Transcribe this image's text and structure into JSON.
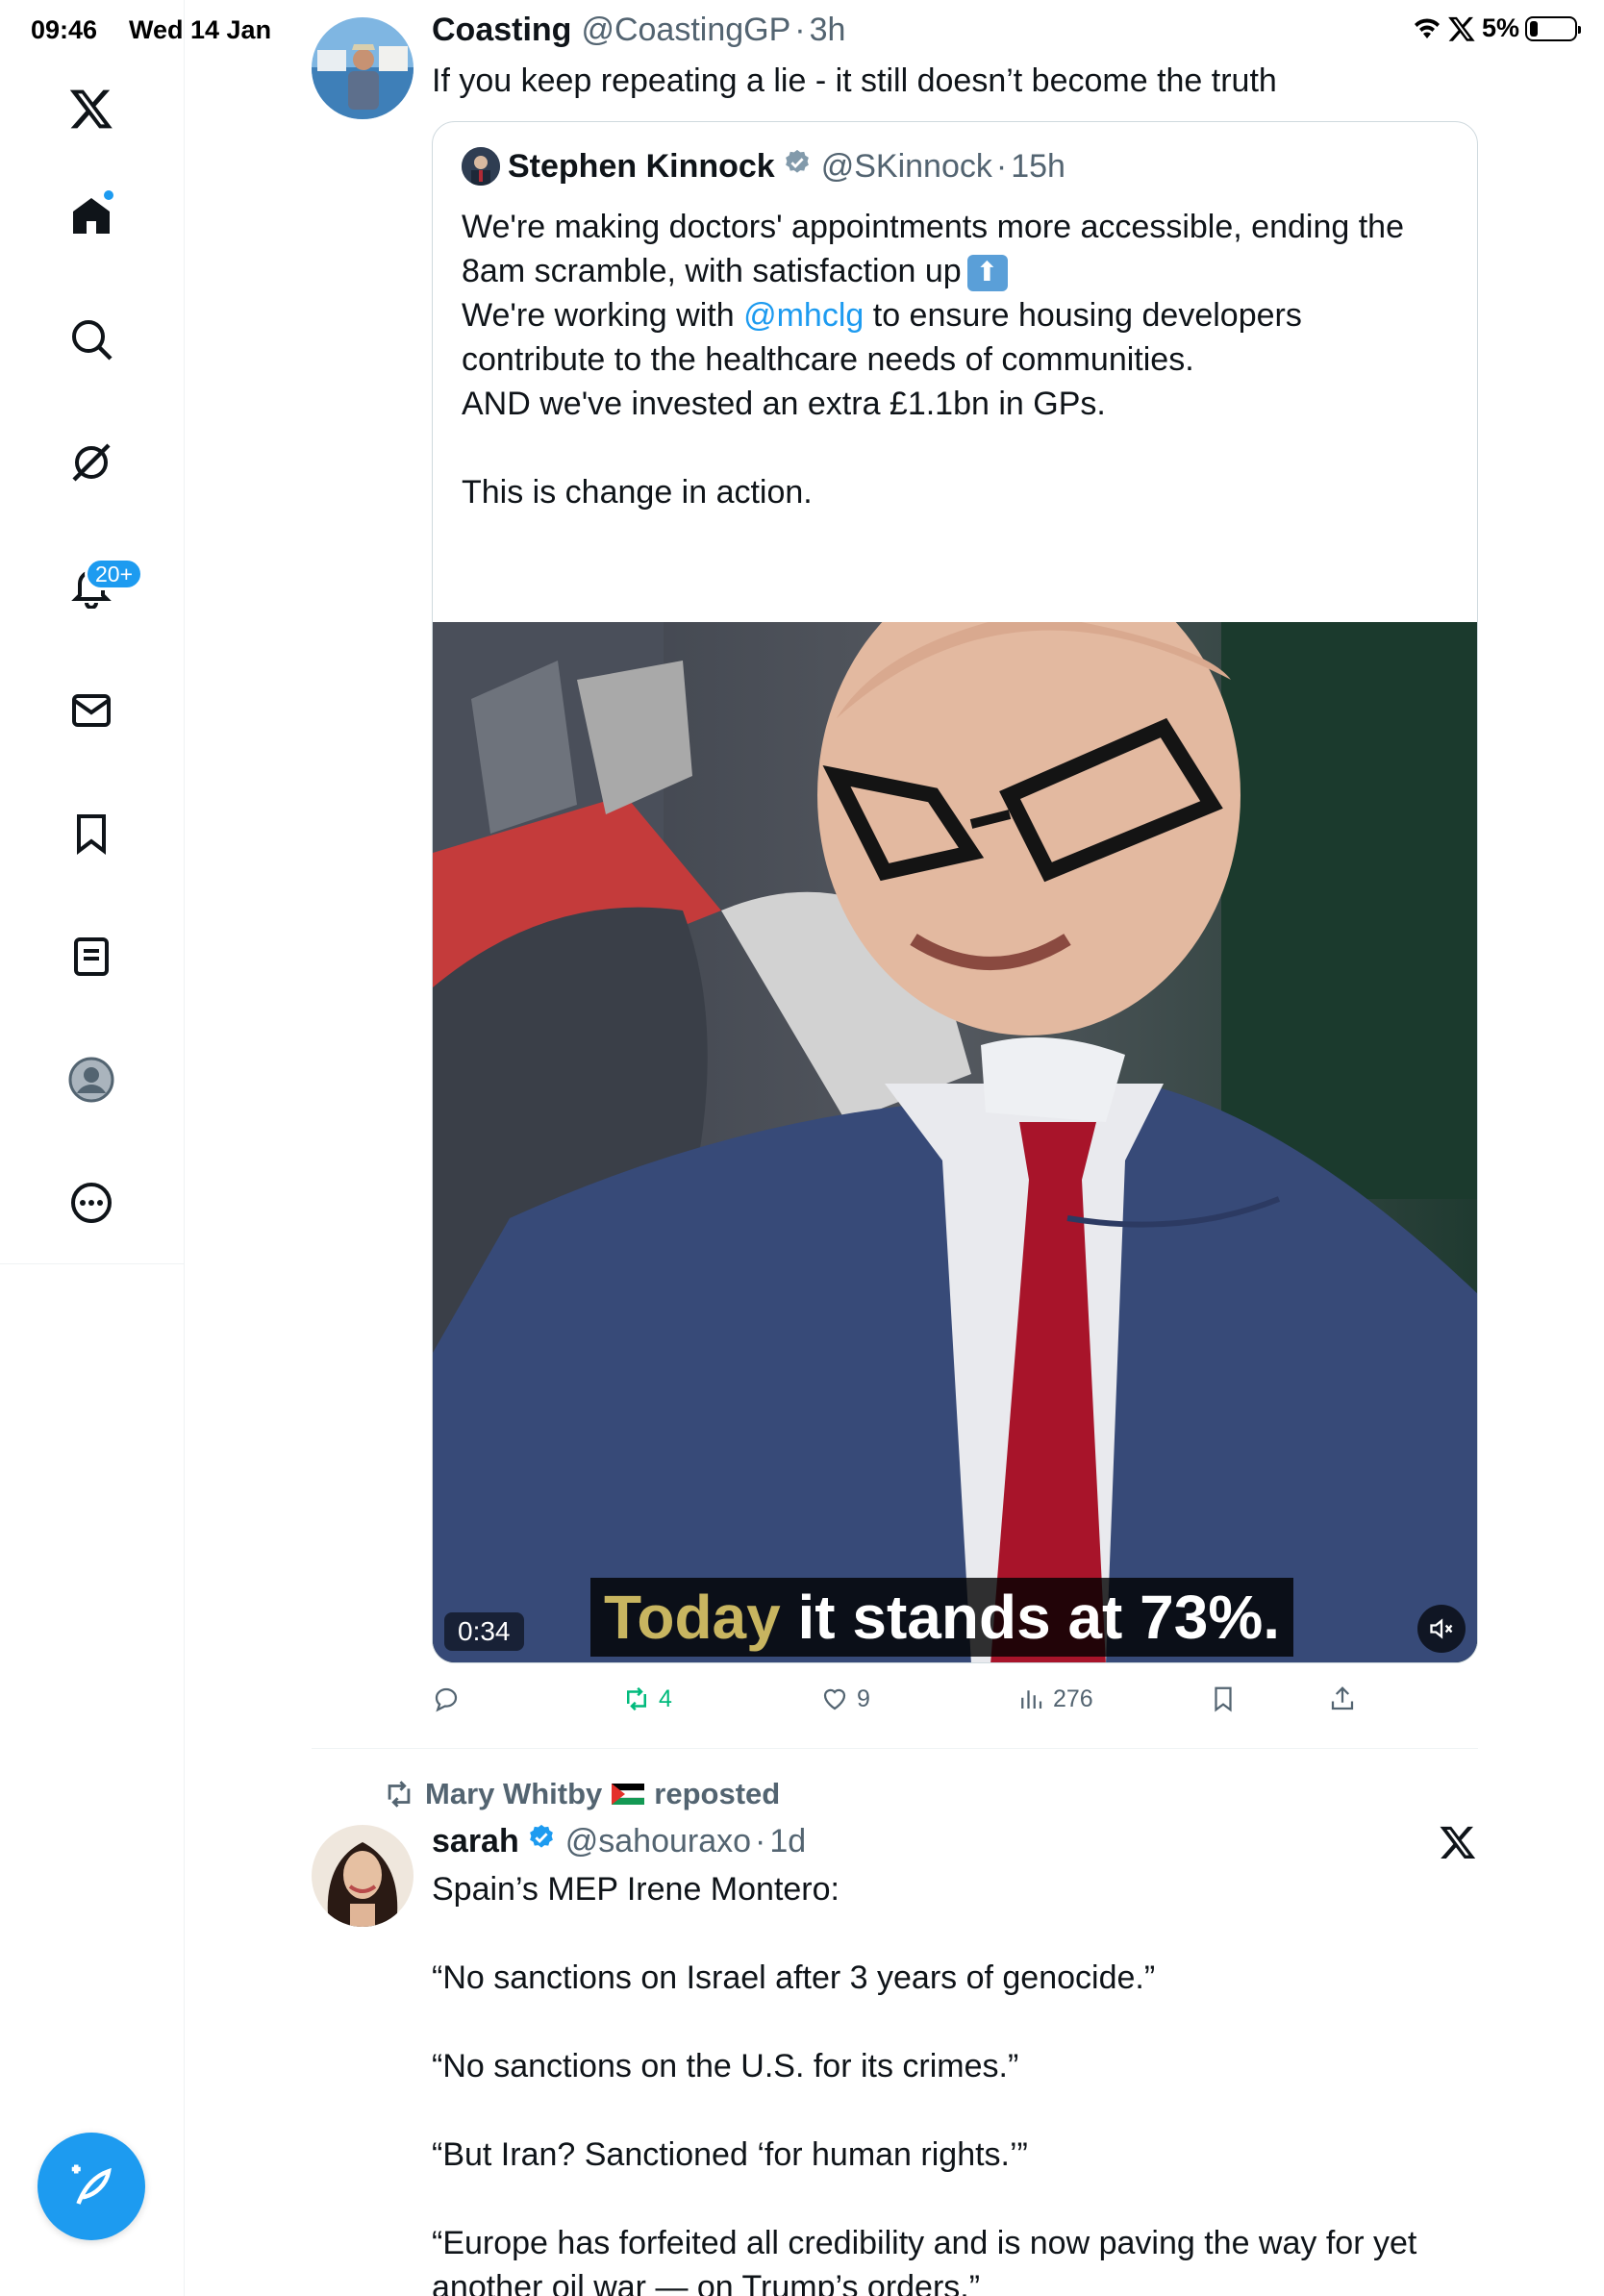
{
  "status_bar": {
    "time": "09:46",
    "date": "Wed 14 Jan",
    "battery": "5%"
  },
  "sidebar": {
    "items": [
      {
        "name": "x-logo"
      },
      {
        "name": "home"
      },
      {
        "name": "search"
      },
      {
        "name": "grok"
      },
      {
        "name": "notifications",
        "badge": "20+"
      },
      {
        "name": "messages"
      },
      {
        "name": "bookmarks"
      },
      {
        "name": "lists"
      },
      {
        "name": "profile"
      },
      {
        "name": "more"
      }
    ],
    "compose_label": "Compose post"
  },
  "tweet1": {
    "name": "Coasting",
    "handle": "@CoastingGP",
    "time": "3h",
    "text": "If you keep repeating a lie - it still doesn’t become the truth",
    "quote": {
      "name": "Stephen Kinnock",
      "handle": "@SKinnock",
      "time": "15h",
      "p1_line1": "We're making doctors' appointments more accessible, ending the",
      "p1_line2": "8am scramble, with satisfaction up",
      "p2_pre": "We're working with",
      "p2_mention": "@mhclg",
      "p2_post": "to ensure housing developers",
      "p2_line2": "contribute to the healthcare needs of communities.",
      "p3": "AND we've invested an extra £1.1bn in GPs.",
      "p4": "This is change in action.",
      "video": {
        "timecode": "0:34",
        "caption_highlight": "Today",
        "caption_rest": "it stands at 73%."
      }
    },
    "stats": {
      "reposts": "4",
      "likes": "9",
      "views": "276"
    }
  },
  "tweet2": {
    "reposted_by": "Mary Whitby",
    "reposted_label": "reposted",
    "name": "sarah",
    "handle": "@sahouraxo",
    "time": "1d",
    "lines": [
      "Spain’s MEP Irene Montero:",
      "“No sanctions on Israel after 3 years of genocide.”",
      "“No sanctions on the U.S. for its crimes.”",
      "“But Iran? Sanctioned ‘for human rights.’”",
      "“Europe has forfeited all credibility and is now paving the way for yet",
      "another oil war — on Trump’s orders.”"
    ]
  },
  "colors": {
    "accent": "#1d9bf0",
    "text": "#0f1419",
    "secondary": "#536471",
    "repost_green": "#00ba7c"
  }
}
